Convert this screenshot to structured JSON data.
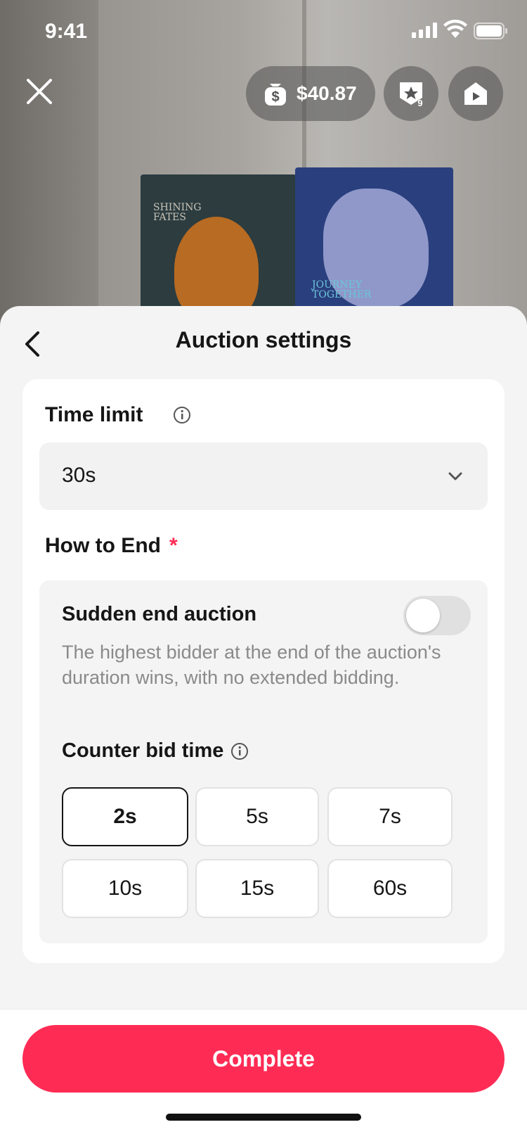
{
  "status_bar": {
    "time": "9:41"
  },
  "top_bar": {
    "wallet_amount": "$40.87",
    "badge_count": "9"
  },
  "sheet": {
    "title": "Auction settings",
    "time_limit": {
      "label": "Time limit",
      "value": "30s"
    },
    "how_to_end": {
      "label": "How to End",
      "required_mark": "*",
      "sudden_end": {
        "label": "Sudden end auction",
        "description": "The highest bidder at the end of the auction's duration wins, with no extended bidding.",
        "enabled": false
      },
      "counter_bid": {
        "label": "Counter bid time",
        "options": [
          "2s",
          "5s",
          "7s",
          "10s",
          "15s",
          "60s"
        ],
        "selected": "2s"
      }
    },
    "complete_label": "Complete"
  },
  "background_text": {
    "box1": "SHINING FATES",
    "box2": "JOURNEY TOGETHER"
  },
  "colors": {
    "accent": "#fe2c55",
    "sheet_bg": "#f4f4f4",
    "card_bg": "#ffffff"
  }
}
